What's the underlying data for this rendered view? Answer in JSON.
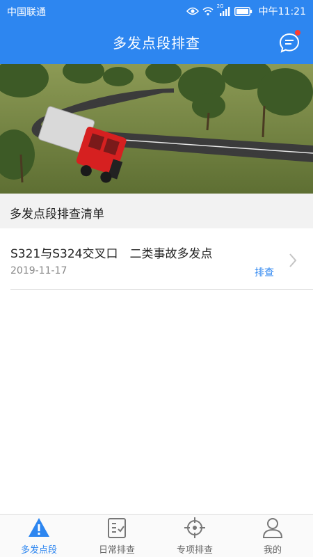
{
  "status_bar": {
    "carrier": "中国联通",
    "network": "2G",
    "time": "中午11:21"
  },
  "header": {
    "title": "多发点段排查",
    "icon": "message-icon",
    "has_notification": true
  },
  "banner": {
    "description_icon": "overturned-truck-banner-image"
  },
  "section": {
    "title": "多发点段排查清单"
  },
  "list": {
    "items": [
      {
        "title": "S321与S324交叉口　二类事故多发点",
        "date": "2019-11-17",
        "action": "排查"
      }
    ]
  },
  "tabs": [
    {
      "label": "多发点段",
      "icon": "warning-icon",
      "active": true
    },
    {
      "label": "日常排查",
      "icon": "checklist-icon",
      "active": false
    },
    {
      "label": "专项排查",
      "icon": "target-icon",
      "active": false
    },
    {
      "label": "我的",
      "icon": "user-icon",
      "active": false
    }
  ],
  "colors": {
    "primary": "#2d86f0",
    "notification_dot": "#ff3b30",
    "section_bg": "#f2f2f2"
  }
}
